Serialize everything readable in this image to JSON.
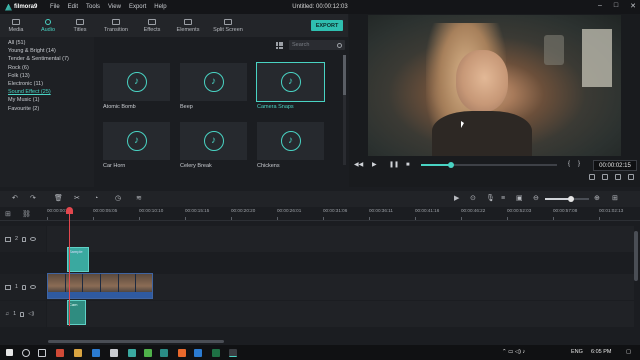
{
  "app": {
    "name": "filmora9",
    "title": "Untitled:",
    "timecode": "00:00:12:03",
    "menu": [
      "File",
      "Edit",
      "Tools",
      "View",
      "Export",
      "Help"
    ],
    "window_controls": [
      "–",
      "□",
      "✕"
    ]
  },
  "tabs": [
    "Media",
    "Audio",
    "Titles",
    "Transition",
    "Effects",
    "Elements",
    "Split Screen"
  ],
  "active_tab": "Audio",
  "export_label": "EXPORT",
  "categories": [
    "All (51)",
    "Young & Bright (14)",
    "Tender & Sentimental (7)",
    "Rock (6)",
    "Folk (13)",
    "Electronic (11)",
    "Sound Effect (25)",
    "My Music (1)",
    "Favourite (2)"
  ],
  "active_category": "Sound Effect (25)",
  "search": {
    "placeholder": "Search"
  },
  "tiles": [
    "Atomic Bomb",
    "Beep",
    "Camera Snaps",
    "Car Horn",
    "Celery Break",
    "Chickens"
  ],
  "selected_tile": "Camera Snaps",
  "preview": {
    "timecode": "00:00:02:15",
    "progress": 0.22,
    "bracket_left": "{",
    "bracket_right": "}"
  },
  "timeline": {
    "ruler": [
      "00:00:00:00",
      "00:00:05:05",
      "00:00:10:10",
      "00:00:15:15",
      "00:00:20:20",
      "00:00:26:01",
      "00:00:31:06",
      "00:00:36:11",
      "00:00:41:16",
      "00:00:46:22",
      "00:00:52:03",
      "00:00:57:08",
      "00:01:02:13"
    ],
    "tracks": [
      {
        "number": "2",
        "clip_label": "Sample"
      },
      {
        "number": "1",
        "clip_label": ""
      },
      {
        "number": "1",
        "clip_label": "Cam"
      }
    ],
    "zoom_level": 0.6
  },
  "taskbar": {
    "language": "ENG",
    "time": "6:05 PM"
  },
  "colors": {
    "accent": "#49d3c3",
    "playhead": "#e2474e",
    "video_clip": "#2f5aa0"
  }
}
